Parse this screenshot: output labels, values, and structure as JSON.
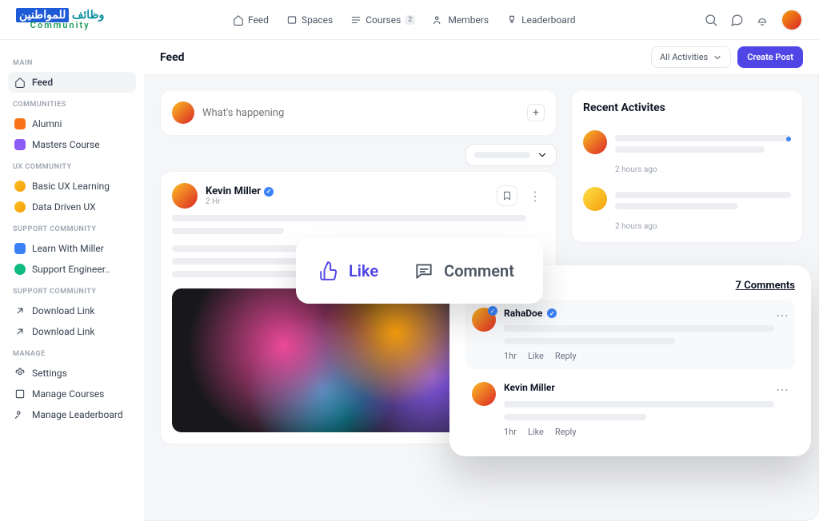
{
  "logo": {
    "arabic_left": "وظائف",
    "arabic_right": "للمواطنين",
    "sub": "Community"
  },
  "topnav": {
    "feed": "Feed",
    "spaces": "Spaces",
    "courses": "Courses",
    "courses_badge": "2",
    "members": "Members",
    "leaderboard": "Leaderboard"
  },
  "sidebar": {
    "main_label": "MAIN",
    "feed": "Feed",
    "communities_label": "COMMUNITIES",
    "alumni": "Alumni",
    "masters": "Masters Course",
    "ux_label": "UX COMMUNITY",
    "basic_ux": "Basic UX Learning",
    "data_ux": "Data Driven UX",
    "support_label": "SUPPORT COMMUNITY",
    "learn_miller": "Learn With Miller",
    "support_eng": "Support Engineer..",
    "support2_label": "SUPPORT COMMUNITY",
    "dl1": "Download Link",
    "dl2": "Download Link",
    "manage_label": "MANAGE",
    "settings": "Settings",
    "manage_courses": "Manage Courses",
    "manage_leaderboard": "Manage Leaderboard"
  },
  "header": {
    "title": "Feed",
    "filter": "All Activities",
    "create": "Create Post"
  },
  "composer": {
    "placeholder": "What's happening"
  },
  "post": {
    "author": "Kevin Miller",
    "time": "2 Hr"
  },
  "actions": {
    "like": "Like",
    "comment": "Comment"
  },
  "recent": {
    "title": "Recent Activites",
    "time1": "2 hours ago",
    "time2": "2 hours ago"
  },
  "comments": {
    "count_label": "7 Comments",
    "c1_name": "RahaDoe",
    "c1_time": "1hr",
    "c1_like": "Like",
    "c1_reply": "Reply",
    "c2_name": "Kevin Miller",
    "c2_time": "1hr",
    "c2_like": "Like",
    "c2_reply": "Reply"
  }
}
